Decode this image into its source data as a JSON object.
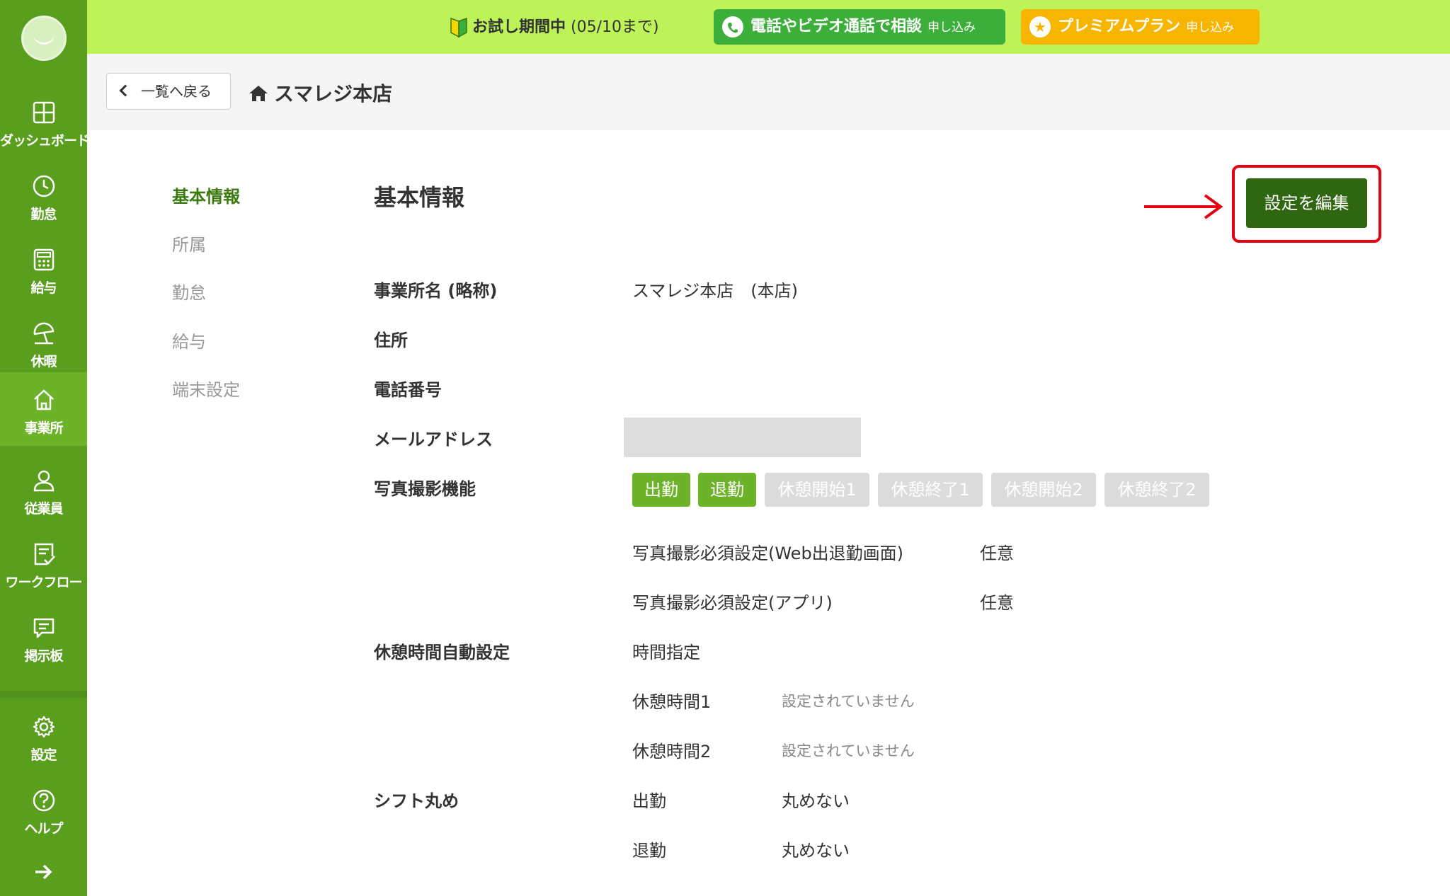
{
  "sidebar": {
    "items": [
      {
        "label": "ダッシュボード",
        "icon": "dashboard-icon"
      },
      {
        "label": "勤怠",
        "icon": "clock-icon"
      },
      {
        "label": "給与",
        "icon": "calculator-icon"
      },
      {
        "label": "休暇",
        "icon": "umbrella-icon"
      },
      {
        "label": "事業所",
        "icon": "home-icon"
      },
      {
        "label": "従業員",
        "icon": "person-icon"
      },
      {
        "label": "ワークフロー",
        "icon": "checklist-icon"
      },
      {
        "label": "掲示板",
        "icon": "message-icon"
      },
      {
        "label": "設定",
        "icon": "gear-icon"
      },
      {
        "label": "ヘルプ",
        "icon": "help-icon"
      }
    ],
    "active": "事業所"
  },
  "banner": {
    "trial_label": "お試し期間中",
    "trial_period": "(05/10まで)",
    "call_label": "電話やビデオ通話で相談",
    "call_sub": "申し込み",
    "premium_label": "プレミアムプラン",
    "premium_sub": "申し込み",
    "colors": {
      "banner": "#bdf258",
      "call": "#3cae3a",
      "premium": "#f7b500"
    }
  },
  "header": {
    "back_label": "一覧へ戻る",
    "store_name": "スマレジ本店"
  },
  "subnav": [
    "基本情報",
    "所属",
    "勤怠",
    "給与",
    "端末設定"
  ],
  "main": {
    "section_title": "基本情報",
    "edit_button": "設定を編集",
    "office_name_label": "事業所名 (略称)",
    "office_name_value": "スマレジ本店　(本店)",
    "address_label": "住所",
    "phone_label": "電話番号",
    "email_label": "メールアドレス",
    "photo_label": "写真撮影機能",
    "photo_tags": [
      {
        "label": "出勤",
        "enabled": true
      },
      {
        "label": "退勤",
        "enabled": true
      },
      {
        "label": "休憩開始1",
        "enabled": false
      },
      {
        "label": "休憩終了1",
        "enabled": false
      },
      {
        "label": "休憩開始2",
        "enabled": false
      },
      {
        "label": "休憩終了2",
        "enabled": false
      }
    ],
    "photo_web_label": "写真撮影必須設定(Web出退勤画面)",
    "photo_web_value": "任意",
    "photo_app_label": "写真撮影必須設定(アプリ)",
    "photo_app_value": "任意",
    "break_label": "休憩時間自動設定",
    "break_mode": "時間指定",
    "break1_label": "休憩時間1",
    "break1_value": "設定されていません",
    "break2_label": "休憩時間2",
    "break2_value": "設定されていません",
    "shift_round_label": "シフト丸め",
    "shift_in_label": "出勤",
    "shift_in_value": "丸めない",
    "shift_out_label": "退勤",
    "shift_out_value": "丸めない"
  },
  "accent_colors": {
    "active_nav": "#3b7a0f",
    "edit_button": "#2f6610",
    "highlight": "#e60012"
  }
}
